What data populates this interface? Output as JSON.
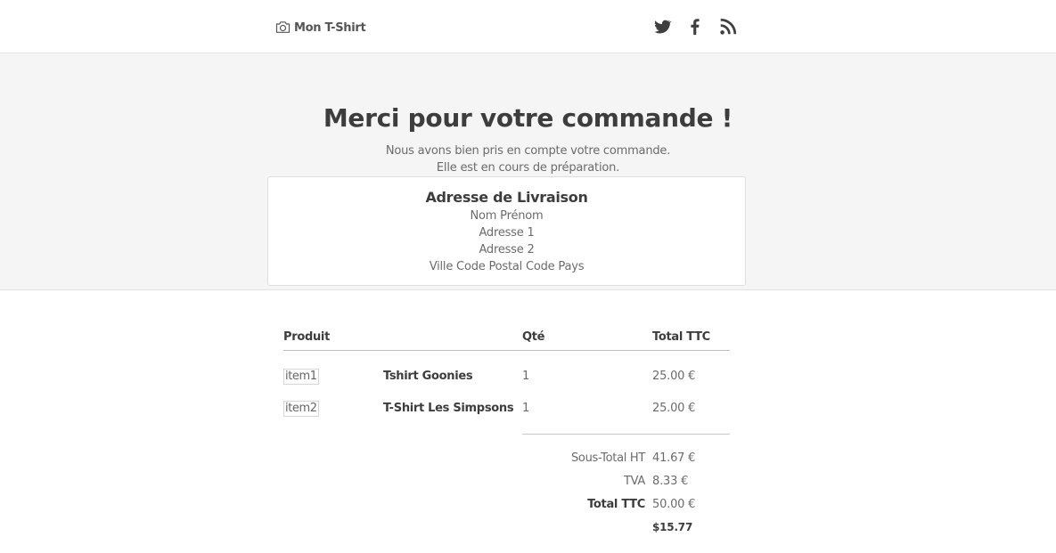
{
  "header": {
    "brand": "Mon T-Shirt",
    "brand_icon": "camera-icon",
    "social": [
      {
        "name": "twitter-icon"
      },
      {
        "name": "facebook-icon"
      },
      {
        "name": "rss-icon"
      }
    ]
  },
  "hero": {
    "title": "Merci pour votre commande !",
    "message_line1": "Nous avons bien pris en compte votre commande.",
    "message_line2": "Elle est en cours de préparation."
  },
  "address": {
    "title": "Adresse de Livraison",
    "name": "Nom Prénom",
    "line1": "Adresse 1",
    "line2": "Adresse 2",
    "line3": "Ville Code Postal Code Pays"
  },
  "table": {
    "headers": {
      "product": "Produit",
      "qty": "Qté",
      "total": "Total TTC"
    },
    "rows": [
      {
        "image_alt": "item1",
        "name": "Tshirt Goonies",
        "qty": "1",
        "total": "25.00 €"
      },
      {
        "image_alt": "item2",
        "name": "T-Shirt Les Simpsons",
        "qty": "1",
        "total": "25.00 €"
      }
    ]
  },
  "summary": {
    "subtotal_label": "Sous-Total HT",
    "subtotal_value": "41.67 €",
    "tax_label": "TVA",
    "tax_value": "8.33 €",
    "total_label": "Total TTC",
    "total_value": "50.00 €",
    "extra_value": "$15.77"
  },
  "colors": {
    "text": "#555555",
    "heading": "#3d3d3d",
    "hero_bg": "#f5f5f5"
  }
}
